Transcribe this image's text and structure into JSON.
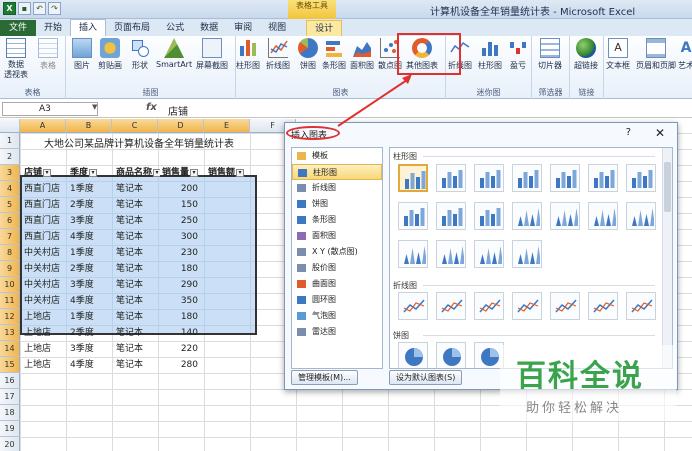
{
  "window": {
    "title": "计算机设备全年销量统计表 - Microsoft Excel",
    "context_tab_group": "表格工具"
  },
  "tabs": [
    {
      "label": "文件",
      "kind": "file"
    },
    {
      "label": "开始",
      "kind": "normal"
    },
    {
      "label": "插入",
      "kind": "active"
    },
    {
      "label": "页面布局",
      "kind": "normal"
    },
    {
      "label": "公式",
      "kind": "normal"
    },
    {
      "label": "数据",
      "kind": "normal"
    },
    {
      "label": "审阅",
      "kind": "normal"
    },
    {
      "label": "视图",
      "kind": "normal"
    },
    {
      "label": "设计",
      "kind": "ctx"
    }
  ],
  "ribbon": {
    "groups": {
      "tables": "表格",
      "illustrations": "插图",
      "charts": "图表",
      "sparklines": "迷你图",
      "filter": "筛选器",
      "links": "链接"
    },
    "buttons": {
      "pivot": "数据\n透视表",
      "table": "表格",
      "picture": "图片",
      "clipart": "剪贴画",
      "shapes": "形状",
      "smartart": "SmartArt",
      "screenshot": "屏幕截图",
      "column": "柱形图",
      "line": "折线图",
      "pie": "饼图",
      "bar": "条形图",
      "area": "面积图",
      "scatter": "散点图",
      "other": "其他图表",
      "spark_line": "折线图",
      "spark_column": "柱形图",
      "spark_winloss": "盈亏",
      "slicer": "切片器",
      "hyperlink": "超链接",
      "textbox": "文本框",
      "header_footer": "页眉和页脚",
      "wordart": "艺术"
    }
  },
  "formula_bar": {
    "name_box": "A3",
    "fx": "fx",
    "content": "店铺"
  },
  "columns": [
    "A",
    "B",
    "C",
    "D",
    "E",
    "F"
  ],
  "rows": [
    "1",
    "2",
    "3",
    "4",
    "5",
    "6",
    "7",
    "8",
    "9",
    "10",
    "11",
    "12",
    "13",
    "14",
    "15",
    "16",
    "17",
    "18",
    "19",
    "20"
  ],
  "sheet": {
    "title": "大地公司某品牌计算机设备全年销量统计表",
    "headers": [
      "店铺",
      "季度",
      "商品名称",
      "销售量",
      "销售额"
    ],
    "data": [
      [
        "西直门店",
        "1季度",
        "笔记本",
        "200"
      ],
      [
        "西直门店",
        "2季度",
        "笔记本",
        "150"
      ],
      [
        "西直门店",
        "3季度",
        "笔记本",
        "250"
      ],
      [
        "西直门店",
        "4季度",
        "笔记本",
        "300"
      ],
      [
        "中关村店",
        "1季度",
        "笔记本",
        "230"
      ],
      [
        "中关村店",
        "2季度",
        "笔记本",
        "180"
      ],
      [
        "中关村店",
        "3季度",
        "笔记本",
        "290"
      ],
      [
        "中关村店",
        "4季度",
        "笔记本",
        "350"
      ],
      [
        "上地店",
        "1季度",
        "笔记本",
        "180"
      ],
      [
        "上地店",
        "2季度",
        "笔记本",
        "140"
      ],
      [
        "上地店",
        "3季度",
        "笔记本",
        "220"
      ],
      [
        "上地店",
        "4季度",
        "笔记本",
        "280"
      ]
    ]
  },
  "dialog": {
    "title": "插入图表",
    "help": "?",
    "close": "✕",
    "categories": [
      {
        "label": "模板",
        "icon": "folder-icon",
        "color": "#e8b64a"
      },
      {
        "label": "柱形图",
        "icon": "column-chart-icon",
        "color": "#3f78c2",
        "selected": true
      },
      {
        "label": "折线图",
        "icon": "line-chart-icon",
        "color": "#7a8fb0"
      },
      {
        "label": "饼图",
        "icon": "pie-chart-icon",
        "color": "#3f78c2"
      },
      {
        "label": "条形图",
        "icon": "bar-chart-icon",
        "color": "#3f78c2"
      },
      {
        "label": "面积图",
        "icon": "area-chart-icon",
        "color": "#8c6bb1"
      },
      {
        "label": "X Y (散点图)",
        "icon": "scatter-chart-icon",
        "color": "#7a8fb0"
      },
      {
        "label": "股价图",
        "icon": "stock-chart-icon",
        "color": "#7a8fb0"
      },
      {
        "label": "曲面图",
        "icon": "surface-chart-icon",
        "color": "#e05c2c"
      },
      {
        "label": "圆环图",
        "icon": "doughnut-chart-icon",
        "color": "#3f78c2"
      },
      {
        "label": "气泡图",
        "icon": "bubble-chart-icon",
        "color": "#5a9bd5"
      },
      {
        "label": "雷达图",
        "icon": "radar-chart-icon",
        "color": "#7a8fb0"
      }
    ],
    "sections": {
      "column": "柱形图",
      "line": "折线图",
      "pie": "饼图"
    },
    "buttons": {
      "manage": "管理模板(M)...",
      "default": "设为默认图表(S)"
    }
  },
  "watermark": {
    "main": "百科全说",
    "sub": "助你轻松解决"
  },
  "colors": {
    "accent": "#3f78c2",
    "highlight": "#e03131",
    "watermark": "#3aa34c"
  }
}
